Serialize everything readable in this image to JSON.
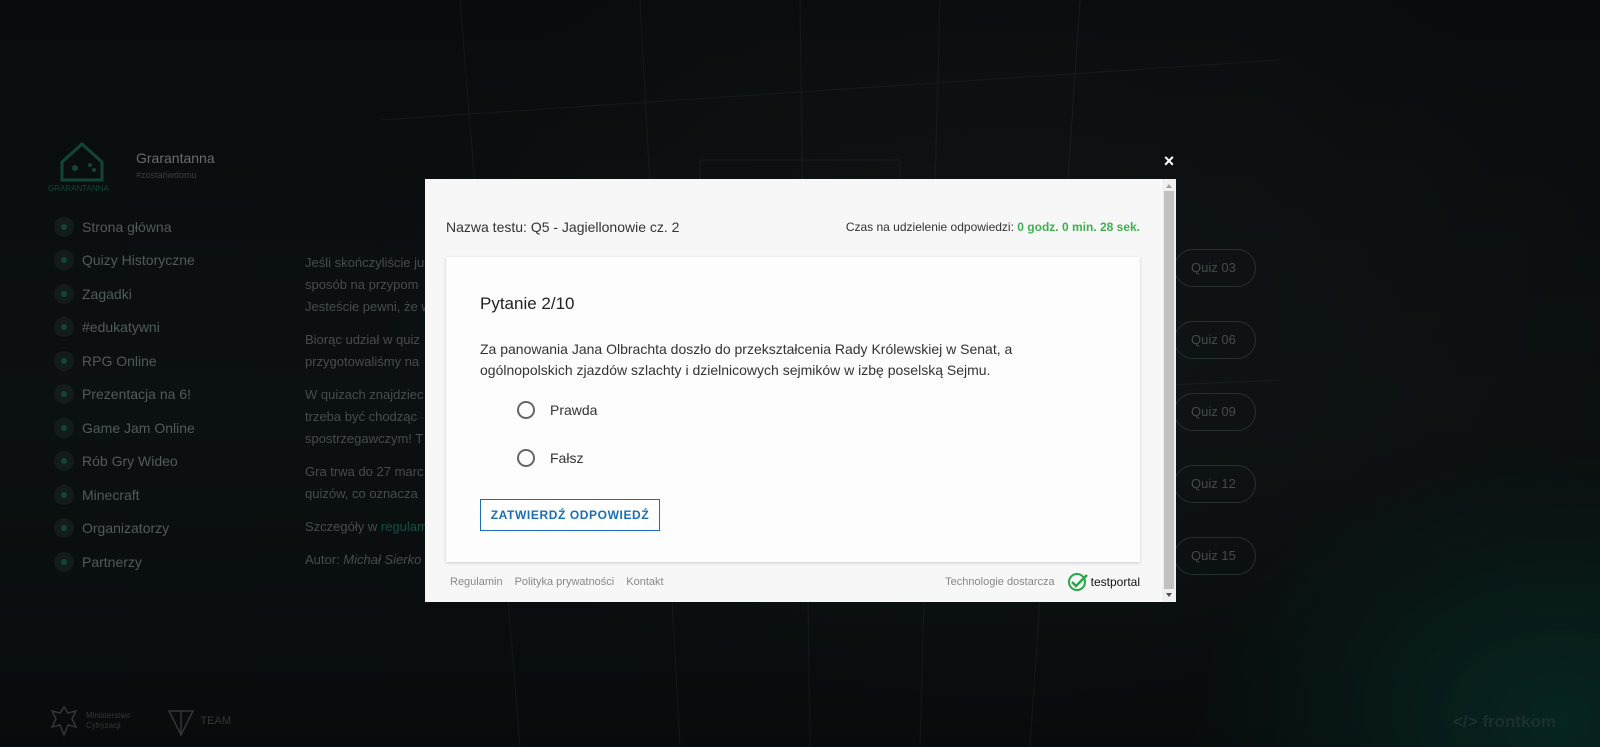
{
  "background": {
    "brand": {
      "name": "Grarantanna",
      "tagline": "#zostańwdomu",
      "logo_caption": "GRARANTANNA"
    },
    "nav": [
      {
        "label": "Strona główna"
      },
      {
        "label": "Quizy Historyczne"
      },
      {
        "label": "Zagadki"
      },
      {
        "label": "#edukatywni"
      },
      {
        "label": "RPG Online"
      },
      {
        "label": "Prezentacja na 6!"
      },
      {
        "label": "Game Jam Online"
      },
      {
        "label": "Rób Gry Wideo"
      },
      {
        "label": "Minecraft"
      },
      {
        "label": "Organizatorzy"
      },
      {
        "label": "Partnerzy"
      }
    ],
    "text": {
      "p1_l1": "Jeśli skończyliście ju",
      "p1_l2": "sposób na przypom",
      "p1_l3": "Jesteście pewni, że w",
      "p2_l1": "Biorąc udział w quiz",
      "p2_l2": "przygotowaliśmy na",
      "p3_l1": "W quizach znajdziec",
      "p3_l2": "trzeba być chodząc",
      "p3_l3": "spostrzegawczym! T",
      "p4_l1": "Gra trwa do 27 marc",
      "p4_l2": "quizów, co oznacza",
      "p5_prefix": "Szczegóły w ",
      "p5_link": "regulam",
      "p6_prefix": "Autor: ",
      "p6_author": "Michał Sierko"
    },
    "quiz_buttons": [
      {
        "label": "Quiz 03"
      },
      {
        "label": "Quiz 06"
      },
      {
        "label": "Quiz 09"
      },
      {
        "label": "Quiz 12"
      },
      {
        "label": "Quiz 15"
      }
    ],
    "footer": {
      "ministry_l1": "Ministerstwo",
      "ministry_l2": "Cyfryzacji",
      "team": "TEAM",
      "frontkom": "frontkom"
    }
  },
  "modal": {
    "close_symbol": "×",
    "test_name": "Nazwa testu: Q5 - Jagiellonowie cz. 2",
    "timer_label": "Czas na udzielenie odpowiedzi: ",
    "timer_value": "0 godz. 0 min. 28 sek.",
    "question_title": "Pytanie 2/10",
    "question_text": "Za panowania Jana Olbrachta doszło do przekształcenia Rady Królewskiej w Senat, a ogólnopolskich zjazdów szlachty i dzielnicowych sejmików w izbę poselską Sejmu.",
    "options": [
      {
        "label": "Prawda"
      },
      {
        "label": "Fałsz"
      }
    ],
    "submit_label": "ZATWIERDŹ ODPOWIEDŹ",
    "footer_links": [
      {
        "label": "Regulamin"
      },
      {
        "label": "Polityka prywatności"
      },
      {
        "label": "Kontakt"
      }
    ],
    "provider_label": "Technologie dostarcza",
    "provider_name": "testportal"
  },
  "colors": {
    "accent_blue": "#1a6fb4",
    "timer_green": "#3eb24f",
    "brand_teal": "#1b6b52"
  }
}
